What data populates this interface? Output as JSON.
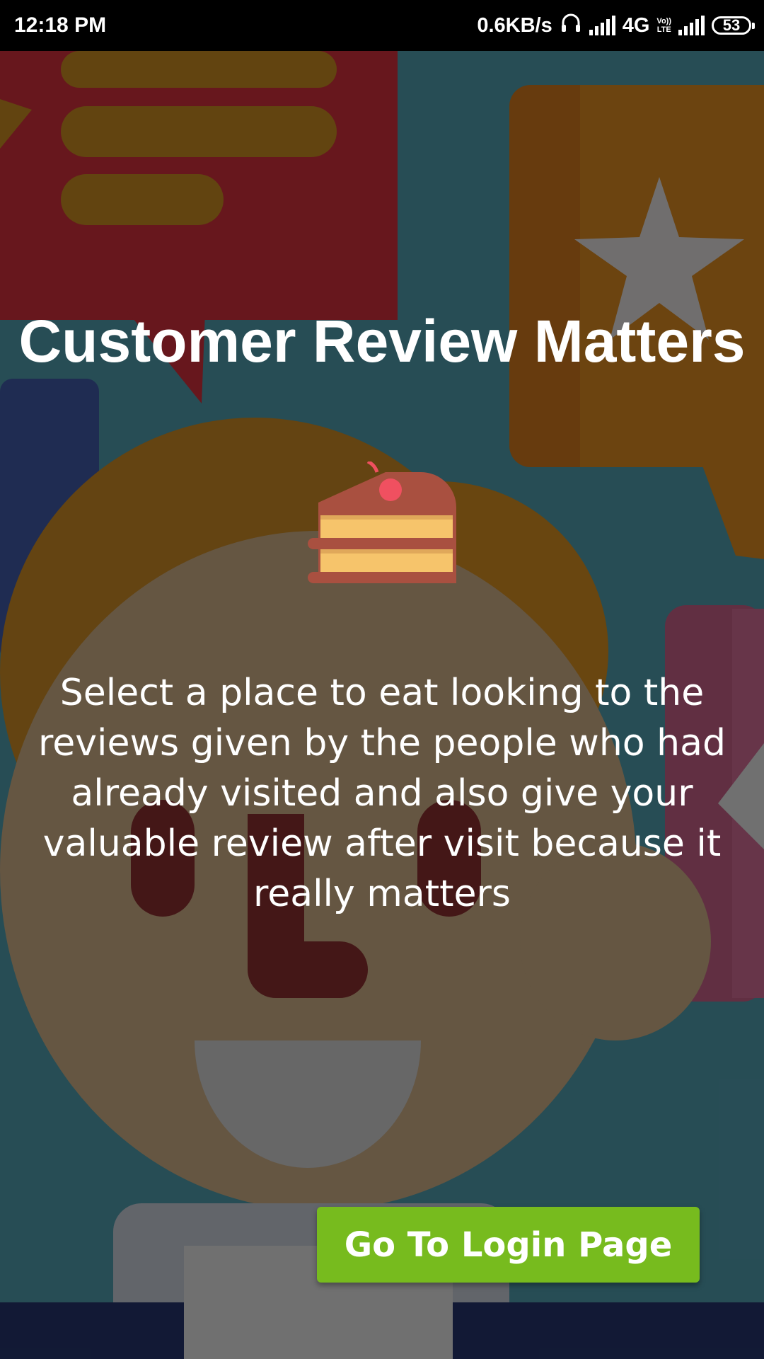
{
  "status_bar": {
    "time": "12:18 PM",
    "speed": "0.6KB/s",
    "network": "4G",
    "volte_top": "Vo))",
    "volte_bottom": "LTE",
    "battery": "53",
    "icons": [
      "headset-icon",
      "signal-icon",
      "volte-icon",
      "signal-icon",
      "battery-icon"
    ]
  },
  "main": {
    "title": "Customer Review Matters",
    "cake_icon": "cake-slice-icon",
    "description": "Select a place to eat looking to the reviews given by the people who had already visited and also give your valuable review after visit because it really matters",
    "login_button_label": "Go To Login Page"
  },
  "colors": {
    "background": "#2b545d",
    "button": "#77bb1e",
    "cake_body": "#a95040",
    "cake_filling": "#f6c46b",
    "cherry": "#f05060"
  }
}
